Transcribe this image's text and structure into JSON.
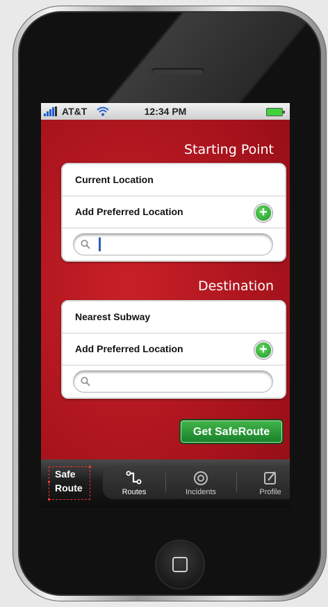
{
  "status": {
    "carrier": "AT&T",
    "time": "12:34 PM"
  },
  "starting": {
    "title": "Starting Point",
    "rows": [
      "Current Location",
      "Add Preferred Location"
    ],
    "search_value": ""
  },
  "destination": {
    "title": "Destination",
    "rows": [
      "Nearest Subway",
      "Add Preferred Location"
    ],
    "search_value": ""
  },
  "action": {
    "label": "Get SafeRoute"
  },
  "logo": {
    "line1": "Safe",
    "line2": "Route"
  },
  "tabs": [
    {
      "label": "Routes",
      "icon": "route-icon"
    },
    {
      "label": "Incidents",
      "icon": "target-icon"
    },
    {
      "label": "Profile",
      "icon": "edit-icon"
    }
  ],
  "colors": {
    "background_red": "#b3141d",
    "button_green": "#2a9a38"
  }
}
